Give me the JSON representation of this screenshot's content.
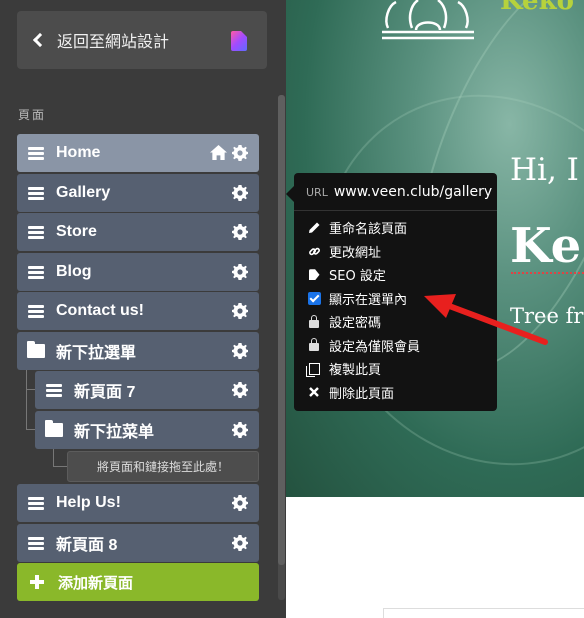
{
  "sidebar": {
    "back_label": "返回至網站設計",
    "section_label": "頁面",
    "pages": [
      {
        "label": "Home",
        "type": "page",
        "is_home": true
      },
      {
        "label": "Gallery",
        "type": "page"
      },
      {
        "label": "Store",
        "type": "page"
      },
      {
        "label": "Blog",
        "type": "page"
      },
      {
        "label": "Contact us!",
        "type": "page"
      },
      {
        "label": "新下拉選單",
        "type": "folder"
      },
      {
        "label": "新頁面 7",
        "type": "page"
      },
      {
        "label": "新下拉菜单",
        "type": "folder"
      },
      {
        "label": "Help Us!",
        "type": "page"
      },
      {
        "label": "新頁面 8",
        "type": "page"
      }
    ],
    "drop_hint": "將頁面和鏈接拖至此處！",
    "add_label": "添加新頁面"
  },
  "context_menu": {
    "url_label": "URL",
    "url_value": "www.veen.club/gallery",
    "items": [
      {
        "label": "重命名該頁面",
        "icon": "pencil-icon"
      },
      {
        "label": "更改網址",
        "icon": "link-icon"
      },
      {
        "label": "SEO 設定",
        "icon": "tag-icon"
      },
      {
        "label": "顯示在選單內",
        "icon": "checkbox-icon",
        "checked": true
      },
      {
        "label": "設定密碼",
        "icon": "lock-icon"
      },
      {
        "label": "設定為僅限會員",
        "icon": "lock-icon"
      },
      {
        "label": "複製此頁",
        "icon": "copy-icon"
      },
      {
        "label": "刪除此頁面",
        "icon": "close-icon"
      }
    ]
  },
  "preview": {
    "brand": "Keko",
    "greeting": "Hi, I a",
    "title": "Ke",
    "subtitle": "Tree fro"
  },
  "colors": {
    "accent_green": "#8ab82a",
    "item_bg": "#566071",
    "item_active_bg": "#8a95a6",
    "checkbox_blue": "#1a73e8",
    "arrow_red": "#e8201e"
  }
}
